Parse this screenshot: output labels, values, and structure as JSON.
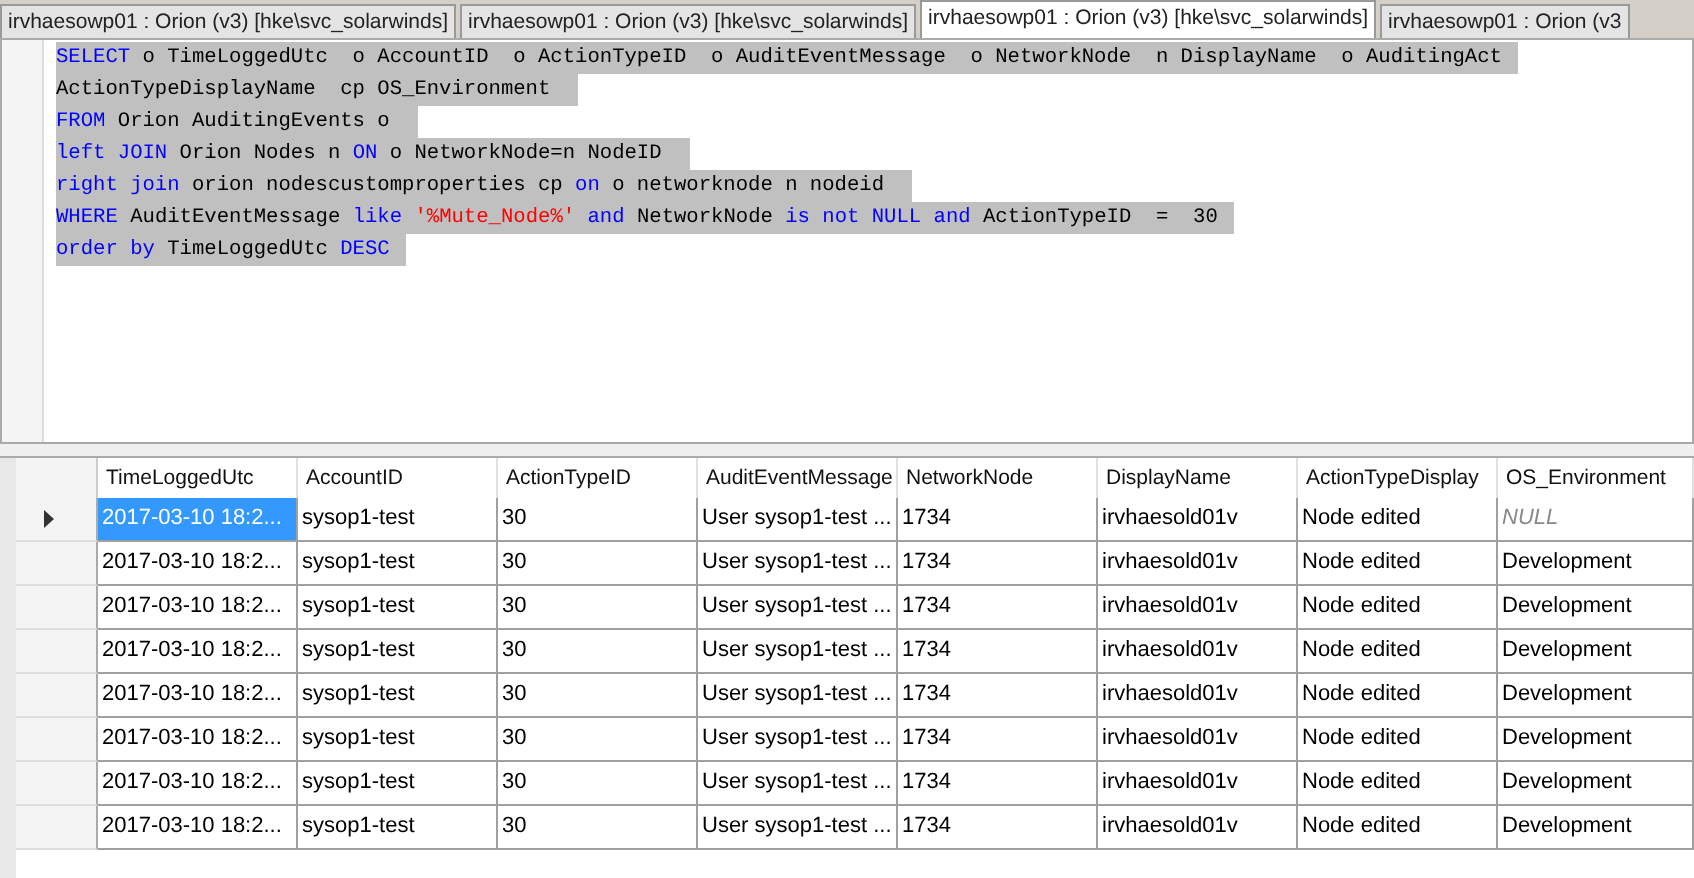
{
  "tabs": [
    {
      "label": "irvhaesowp01 : Orion (v3) [hke\\svc_solarwinds]",
      "selected": false
    },
    {
      "label": "irvhaesowp01 : Orion (v3) [hke\\svc_solarwinds]",
      "selected": false
    },
    {
      "label": "irvhaesowp01 : Orion (v3) [hke\\svc_solarwinds]",
      "selected": true
    },
    {
      "label": "irvhaesowp01 : Orion (v3",
      "selected": false
    }
  ],
  "editor": {
    "lines": [
      [
        {
          "kind": "keyword",
          "text": "SELECT"
        },
        {
          "kind": "plain",
          "text": " o TimeLoggedUtc  o AccountID  o ActionTypeID  o AuditEventMessage  o NetworkNode  n DisplayName  o AuditingAct"
        }
      ],
      [
        {
          "kind": "plain",
          "text": "ActionTypeDisplayName  cp OS_Environment "
        }
      ],
      [
        {
          "kind": "keyword",
          "text": "FROM"
        },
        {
          "kind": "plain",
          "text": " Orion AuditingEvents o "
        }
      ],
      [
        {
          "kind": "keyword",
          "text": "left JOIN"
        },
        {
          "kind": "plain",
          "text": " Orion Nodes n "
        },
        {
          "kind": "keyword",
          "text": "ON"
        },
        {
          "kind": "plain",
          "text": " o NetworkNode=n NodeID "
        }
      ],
      [
        {
          "kind": "keyword",
          "text": "right join"
        },
        {
          "kind": "plain",
          "text": " orion nodescustomproperties cp "
        },
        {
          "kind": "keyword",
          "text": "on"
        },
        {
          "kind": "plain",
          "text": " o networknode n nodeid "
        }
      ],
      [
        {
          "kind": "keyword",
          "text": "WHERE"
        },
        {
          "kind": "plain",
          "text": " AuditEventMessage "
        },
        {
          "kind": "keyword",
          "text": "like "
        },
        {
          "kind": "string",
          "text": "'%Mute_Node%'"
        },
        {
          "kind": "keyword",
          "text": " and"
        },
        {
          "kind": "plain",
          "text": " NetworkNode "
        },
        {
          "kind": "keyword",
          "text": "is not NULL and"
        },
        {
          "kind": "plain",
          "text": " ActionTypeID  =  30"
        }
      ],
      [
        {
          "kind": "keyword",
          "text": "order by"
        },
        {
          "kind": "plain",
          "text": " TimeLoggedUtc "
        },
        {
          "kind": "keyword",
          "text": "DESC"
        }
      ]
    ]
  },
  "grid": {
    "columns": [
      "TimeLoggedUtc",
      "AccountID",
      "ActionTypeID",
      "AuditEventMessage",
      "NetworkNode",
      "DisplayName",
      "ActionTypeDisplay",
      "OS_Environment"
    ],
    "rows": [
      {
        "current": true,
        "cells": [
          {
            "text": "2017-03-10 18:2...",
            "selected": true,
            "null": false
          },
          {
            "text": "sysop1-test",
            "selected": false,
            "null": false
          },
          {
            "text": "30",
            "selected": false,
            "null": false
          },
          {
            "text": "User sysop1-test ...",
            "selected": false,
            "null": false
          },
          {
            "text": "1734",
            "selected": false,
            "null": false
          },
          {
            "text": "irvhaesold01v",
            "selected": false,
            "null": false
          },
          {
            "text": "Node edited",
            "selected": false,
            "null": false
          },
          {
            "text": "NULL",
            "selected": false,
            "null": true
          }
        ]
      },
      {
        "current": false,
        "cells": [
          {
            "text": "2017-03-10 18:2...",
            "selected": false,
            "null": false
          },
          {
            "text": "sysop1-test",
            "selected": false,
            "null": false
          },
          {
            "text": "30",
            "selected": false,
            "null": false
          },
          {
            "text": "User sysop1-test ...",
            "selected": false,
            "null": false
          },
          {
            "text": "1734",
            "selected": false,
            "null": false
          },
          {
            "text": "irvhaesold01v",
            "selected": false,
            "null": false
          },
          {
            "text": "Node edited",
            "selected": false,
            "null": false
          },
          {
            "text": "Development",
            "selected": false,
            "null": false
          }
        ]
      },
      {
        "current": false,
        "cells": [
          {
            "text": "2017-03-10 18:2...",
            "selected": false,
            "null": false
          },
          {
            "text": "sysop1-test",
            "selected": false,
            "null": false
          },
          {
            "text": "30",
            "selected": false,
            "null": false
          },
          {
            "text": "User sysop1-test ...",
            "selected": false,
            "null": false
          },
          {
            "text": "1734",
            "selected": false,
            "null": false
          },
          {
            "text": "irvhaesold01v",
            "selected": false,
            "null": false
          },
          {
            "text": "Node edited",
            "selected": false,
            "null": false
          },
          {
            "text": "Development",
            "selected": false,
            "null": false
          }
        ]
      },
      {
        "current": false,
        "cells": [
          {
            "text": "2017-03-10 18:2...",
            "selected": false,
            "null": false
          },
          {
            "text": "sysop1-test",
            "selected": false,
            "null": false
          },
          {
            "text": "30",
            "selected": false,
            "null": false
          },
          {
            "text": "User sysop1-test ...",
            "selected": false,
            "null": false
          },
          {
            "text": "1734",
            "selected": false,
            "null": false
          },
          {
            "text": "irvhaesold01v",
            "selected": false,
            "null": false
          },
          {
            "text": "Node edited",
            "selected": false,
            "null": false
          },
          {
            "text": "Development",
            "selected": false,
            "null": false
          }
        ]
      },
      {
        "current": false,
        "cells": [
          {
            "text": "2017-03-10 18:2...",
            "selected": false,
            "null": false
          },
          {
            "text": "sysop1-test",
            "selected": false,
            "null": false
          },
          {
            "text": "30",
            "selected": false,
            "null": false
          },
          {
            "text": "User sysop1-test ...",
            "selected": false,
            "null": false
          },
          {
            "text": "1734",
            "selected": false,
            "null": false
          },
          {
            "text": "irvhaesold01v",
            "selected": false,
            "null": false
          },
          {
            "text": "Node edited",
            "selected": false,
            "null": false
          },
          {
            "text": "Development",
            "selected": false,
            "null": false
          }
        ]
      },
      {
        "current": false,
        "cells": [
          {
            "text": "2017-03-10 18:2...",
            "selected": false,
            "null": false
          },
          {
            "text": "sysop1-test",
            "selected": false,
            "null": false
          },
          {
            "text": "30",
            "selected": false,
            "null": false
          },
          {
            "text": "User sysop1-test ...",
            "selected": false,
            "null": false
          },
          {
            "text": "1734",
            "selected": false,
            "null": false
          },
          {
            "text": "irvhaesold01v",
            "selected": false,
            "null": false
          },
          {
            "text": "Node edited",
            "selected": false,
            "null": false
          },
          {
            "text": "Development",
            "selected": false,
            "null": false
          }
        ]
      },
      {
        "current": false,
        "cells": [
          {
            "text": "2017-03-10 18:2...",
            "selected": false,
            "null": false
          },
          {
            "text": "sysop1-test",
            "selected": false,
            "null": false
          },
          {
            "text": "30",
            "selected": false,
            "null": false
          },
          {
            "text": "User sysop1-test ...",
            "selected": false,
            "null": false
          },
          {
            "text": "1734",
            "selected": false,
            "null": false
          },
          {
            "text": "irvhaesold01v",
            "selected": false,
            "null": false
          },
          {
            "text": "Node edited",
            "selected": false,
            "null": false
          },
          {
            "text": "Development",
            "selected": false,
            "null": false
          }
        ]
      },
      {
        "current": false,
        "cells": [
          {
            "text": "2017-03-10 18:2...",
            "selected": false,
            "null": false
          },
          {
            "text": "sysop1-test",
            "selected": false,
            "null": false
          },
          {
            "text": "30",
            "selected": false,
            "null": false
          },
          {
            "text": "User sysop1-test ...",
            "selected": false,
            "null": false
          },
          {
            "text": "1734",
            "selected": false,
            "null": false
          },
          {
            "text": "irvhaesold01v",
            "selected": false,
            "null": false
          },
          {
            "text": "Node edited",
            "selected": false,
            "null": false
          },
          {
            "text": "Development",
            "selected": false,
            "null": false
          }
        ]
      }
    ]
  }
}
